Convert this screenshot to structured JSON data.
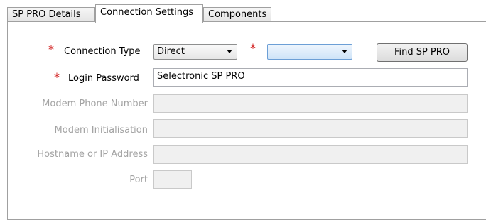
{
  "tabs": [
    {
      "label": "SP PRO Details",
      "active": false
    },
    {
      "label": "Connection Settings",
      "active": true
    },
    {
      "label": "Components",
      "active": false
    }
  ],
  "form": {
    "required_marker": "*",
    "connection_type": {
      "label": "Connection Type",
      "value": "Direct"
    },
    "port_select": {
      "value": ""
    },
    "find_button": "Find SP PRO",
    "login_password": {
      "label": "Login Password",
      "value": "Selectronic SP PRO"
    },
    "modem_phone": {
      "label": "Modem Phone Number",
      "value": ""
    },
    "modem_init": {
      "label": "Modem Initialisation",
      "value": ""
    },
    "hostname": {
      "label": "Hostname or IP Address",
      "value": ""
    },
    "port": {
      "label": "Port",
      "value": ""
    }
  },
  "colors": {
    "required": "#d22020",
    "disabled_text": "#a3a3a3"
  }
}
